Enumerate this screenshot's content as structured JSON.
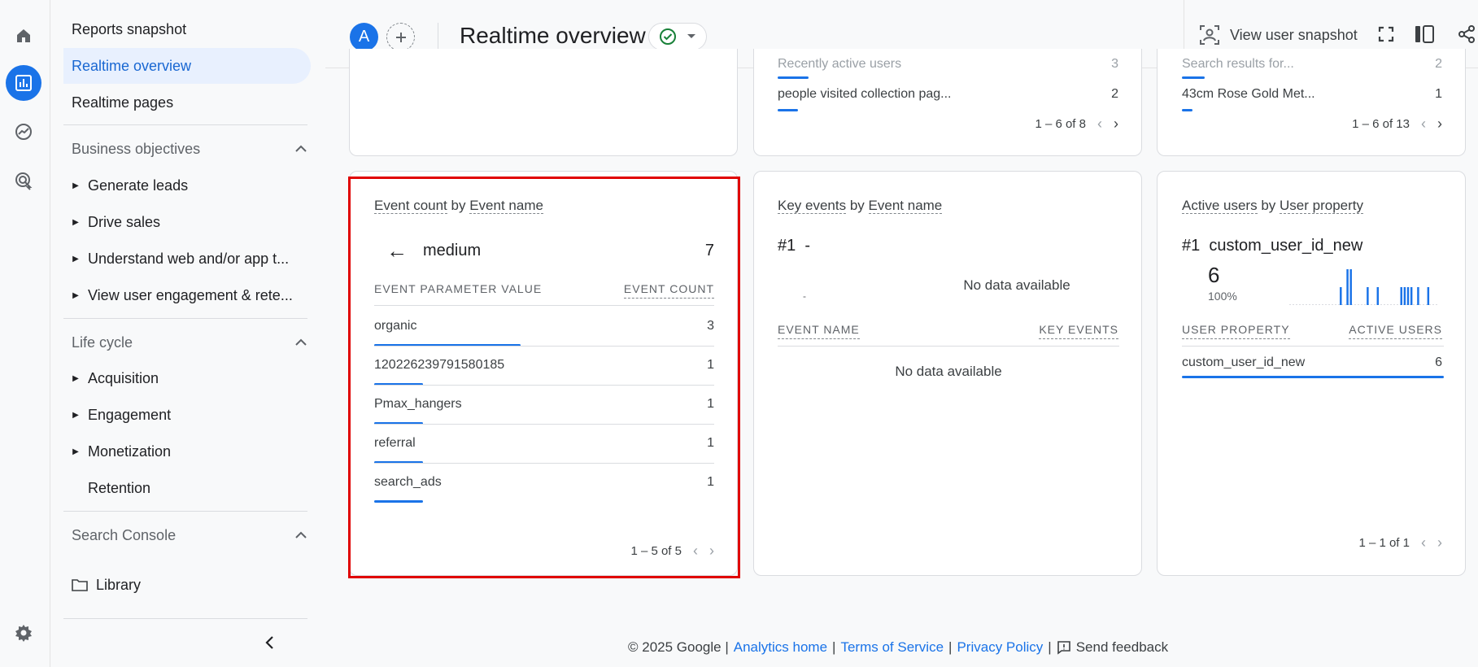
{
  "colors": {
    "accent": "#1a73e8",
    "highlight": "#e00000",
    "success": "#188038"
  },
  "nav": {
    "reports_snapshot": "Reports snapshot",
    "realtime_overview": "Realtime overview",
    "realtime_pages": "Realtime pages",
    "business_objectives": "Business objectives",
    "generate_leads": "Generate leads",
    "drive_sales": "Drive sales",
    "understand_web": "Understand web and/or app t...",
    "view_user_engagement": "View user engagement & rete...",
    "life_cycle": "Life cycle",
    "acquisition": "Acquisition",
    "engagement": "Engagement",
    "monetization": "Monetization",
    "retention": "Retention",
    "search_console": "Search Console",
    "library": "Library"
  },
  "header": {
    "avatar_letter": "A",
    "title": "Realtime overview",
    "view_user_snapshot": "View user snapshot"
  },
  "top_cards": {
    "card2": {
      "row_partial": "Recently active users",
      "row_partial_value": "3",
      "row": "people visited collection pag...",
      "value": "2",
      "pager": "1 – 6 of 8"
    },
    "card3": {
      "row_partial": "Search results for...",
      "row_partial_value": "2",
      "row": "43cm Rose Gold Met...",
      "value": "1",
      "pager": "1 – 6 of 13"
    }
  },
  "event_card": {
    "title_metric": "Event count",
    "title_by": "by",
    "title_dim": "Event name",
    "back_arrow": "←",
    "param_name": "medium",
    "param_total": "7",
    "col_value": "EVENT PARAMETER VALUE",
    "col_count": "EVENT COUNT",
    "rows": [
      {
        "label": "organic",
        "count": "3"
      },
      {
        "label": "120226239791580185",
        "count": "1"
      },
      {
        "label": "Pmax_hangers",
        "count": "1"
      },
      {
        "label": "referral",
        "count": "1"
      },
      {
        "label": "search_ads",
        "count": "1"
      }
    ],
    "pager": "1 – 5 of 5"
  },
  "key_events_card": {
    "title_metric": "Key events",
    "title_by": "by",
    "title_dim": "Event name",
    "rank": "#1",
    "rank_value": "-",
    "no_data_chart": "No data available",
    "dash": "-",
    "col_name": "EVENT NAME",
    "col_value": "KEY EVENTS",
    "no_data_table": "No data available"
  },
  "active_users_card": {
    "title_metric": "Active users",
    "title_by": "by",
    "title_dim": "User property",
    "rank": "#1",
    "rank_value": "custom_user_id_new",
    "big_number": "6",
    "percent": "100%",
    "col_name": "USER PROPERTY",
    "col_value": "ACTIVE USERS",
    "row": "custom_user_id_new",
    "row_value": "6",
    "pager": "1 – 1 of 1",
    "sparkline": [
      0,
      0,
      0,
      0,
      0,
      0,
      0,
      0,
      0,
      0,
      0,
      0,
      0,
      0,
      0,
      2,
      0,
      4,
      4,
      0,
      0,
      0,
      0,
      2,
      0,
      0,
      2,
      0,
      0,
      0,
      0,
      0,
      0,
      2,
      2,
      2,
      2,
      0,
      2,
      0,
      0,
      2,
      0,
      0
    ]
  },
  "footer": {
    "copyright": "© 2025 Google |",
    "analytics_home": "Analytics home",
    "sep1": "|",
    "terms": "Terms of Service",
    "sep2": "|",
    "privacy": "Privacy Policy",
    "sep3": "|",
    "feedback": "Send feedback"
  }
}
